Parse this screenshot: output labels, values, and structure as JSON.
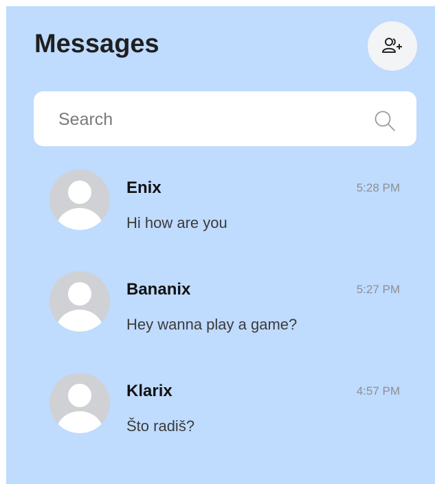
{
  "header": {
    "title": "Messages",
    "add_contact_icon": "add-user-icon"
  },
  "search": {
    "placeholder": "Search",
    "value": "",
    "icon": "search-icon"
  },
  "conversations": [
    {
      "name": "Enix",
      "time": "5:28 PM",
      "preview": "Hi how are you",
      "avatar_icon": "default-avatar-icon"
    },
    {
      "name": "Bananix",
      "time": "5:27 PM",
      "preview": "Hey wanna play a game?",
      "avatar_icon": "default-avatar-icon"
    },
    {
      "name": "Klarix",
      "time": "4:57 PM",
      "preview": "Što radiš?",
      "avatar_icon": "default-avatar-icon"
    }
  ],
  "colors": {
    "panel_background": "#bfdbfe",
    "avatar_background": "#cfd1d4",
    "title_text": "#1f1f1f",
    "time_text": "#8c8f94"
  }
}
